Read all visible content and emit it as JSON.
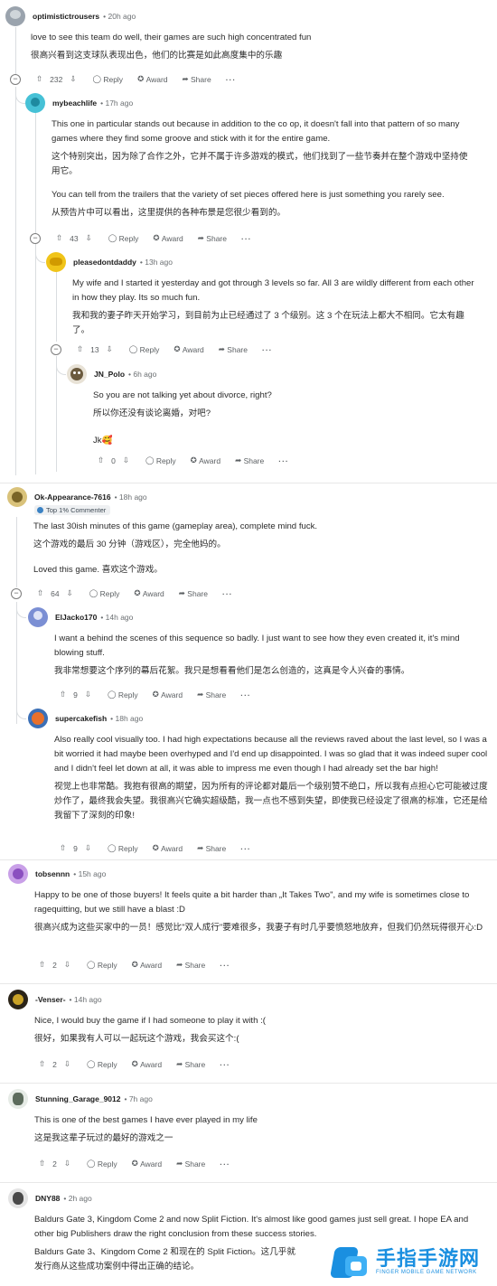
{
  "actions": {
    "reply": "Reply",
    "award": "Award",
    "share": "Share",
    "more": "···"
  },
  "comments": {
    "c1": {
      "user": "optimistictrousers",
      "time": "• 20h ago",
      "lines": [
        "love to see this team do well, their games are such high concentrated fun",
        "很高兴看到这支球队表现出色，他们的比赛是如此高度集中的乐趣"
      ],
      "votes": "232"
    },
    "c2": {
      "user": "mybeachlife",
      "time": "• 17h ago",
      "lines": [
        "This one in particular stands out because in addition to the co op, it doesn't fall into that pattern of so many games where they find some groove and stick with it for the entire game.",
        "这个特别突出，因为除了合作之外，它并不属于许多游戏的模式，他们找到了一些节奏并在整个游戏中坚持使用它。",
        "You can tell from the trailers that the variety of set pieces offered here is just something you rarely see.",
        "从预告片中可以看出，这里提供的各种布景是您很少看到的。"
      ],
      "votes": "43"
    },
    "c3": {
      "user": "pleasedontdaddy",
      "time": "• 13h ago",
      "lines": [
        "My wife and I started it yesterday and got through 3 levels so far. All 3 are wildly different from each other in how they play. Its so much fun.",
        "我和我的妻子昨天开始学习，到目前为止已经通过了 3 个级别。这 3 个在玩法上都大不相同。它太有趣了。"
      ],
      "votes": "13"
    },
    "c4": {
      "user": "JN_Polo",
      "time": "• 6h ago",
      "lines": [
        "So you are not talking yet about divorce, right?",
        "所以你还没有谈论离婚，对吧?",
        "Jk🥰"
      ],
      "votes": "0"
    },
    "c5": {
      "user": "Ok-Appearance-7616",
      "time": "• 18h ago",
      "badge": "Top 1% Commenter",
      "lines": [
        "The last 30ish minutes of this game (gameplay area), complete mind fuck.",
        "这个游戏的最后 30 分钟（游戏区），完全他妈的。",
        "Loved this game.   喜欢这个游戏。"
      ],
      "votes": "64"
    },
    "c6": {
      "user": "ElJacko170",
      "time": "• 14h ago",
      "lines": [
        "I want a behind the scenes of this sequence so badly. I just want to see how they even created it, it's mind blowing stuff.",
        "我非常想要这个序列的幕后花絮。我只是想看看他们是怎么创造的，这真是令人兴奋的事情。"
      ],
      "votes": "9"
    },
    "c7": {
      "user": "supercakefish",
      "time": "• 18h ago",
      "lines": [
        "Also really cool visually too. I had high expectations because all the reviews raved about the last level, so I was a bit worried it had maybe been overhyped and I'd end up disappointed. I was so glad that it was indeed super cool and I didn't feel let down at all, it was able to impress me even though I had already set the bar high!",
        "视觉上也非常酷。我抱有很高的期望，因为所有的评论都对最后一个级别赞不绝口，所以我有点担心它可能被过度炒作了，最终我会失望。我很高兴它确实超级酷，我一点也不感到失望，即使我已经设定了很高的标准，它还是给我留下了深刻的印象!"
      ],
      "votes": "9"
    },
    "c8": {
      "user": "tobsennn",
      "time": "• 15h ago",
      "lines": [
        "Happy to be one of those buyers! It feels quite a bit harder than „It Takes Two\", and my wife is sometimes close to ragequitting, but we still have a blast :D",
        "很高兴成为这些买家中的一员！感觉比\"双人成行\"要难很多，我妻子有时几乎要愤怒地放弃，但我们仍然玩得很开心:D"
      ],
      "votes": "2"
    },
    "c9": {
      "user": "-Venser-",
      "time": "• 14h ago",
      "lines": [
        "Nice, I would buy the game if I had someone to play it with :(",
        "很好，如果我有人可以一起玩这个游戏，我会买这个:("
      ],
      "votes": "2"
    },
    "c10": {
      "user": "Stunning_Garage_9012",
      "time": "• 7h ago",
      "lines": [
        "This is one of the best games I have ever played in my life",
        "这是我这辈子玩过的最好的游戏之一"
      ],
      "votes": "2"
    },
    "c11": {
      "user": "DNY88",
      "time": "• 2h ago",
      "lines": [
        "Baldurs Gate 3, Kingdom Come 2 and now Split Fiction. It's almost like good games just sell great. I hope EA and other big Publishers draw the right conclusion from these success stories.",
        "Baldurs Gate 3、Kingdom Come 2 和现在的 Split Fiction。这几乎就",
        "发行商从这些成功案例中得出正确的结论。"
      ]
    }
  },
  "watermark": {
    "title": "手指手游网",
    "subtitle": "FINGER MOBILE GAME NETWORK"
  }
}
